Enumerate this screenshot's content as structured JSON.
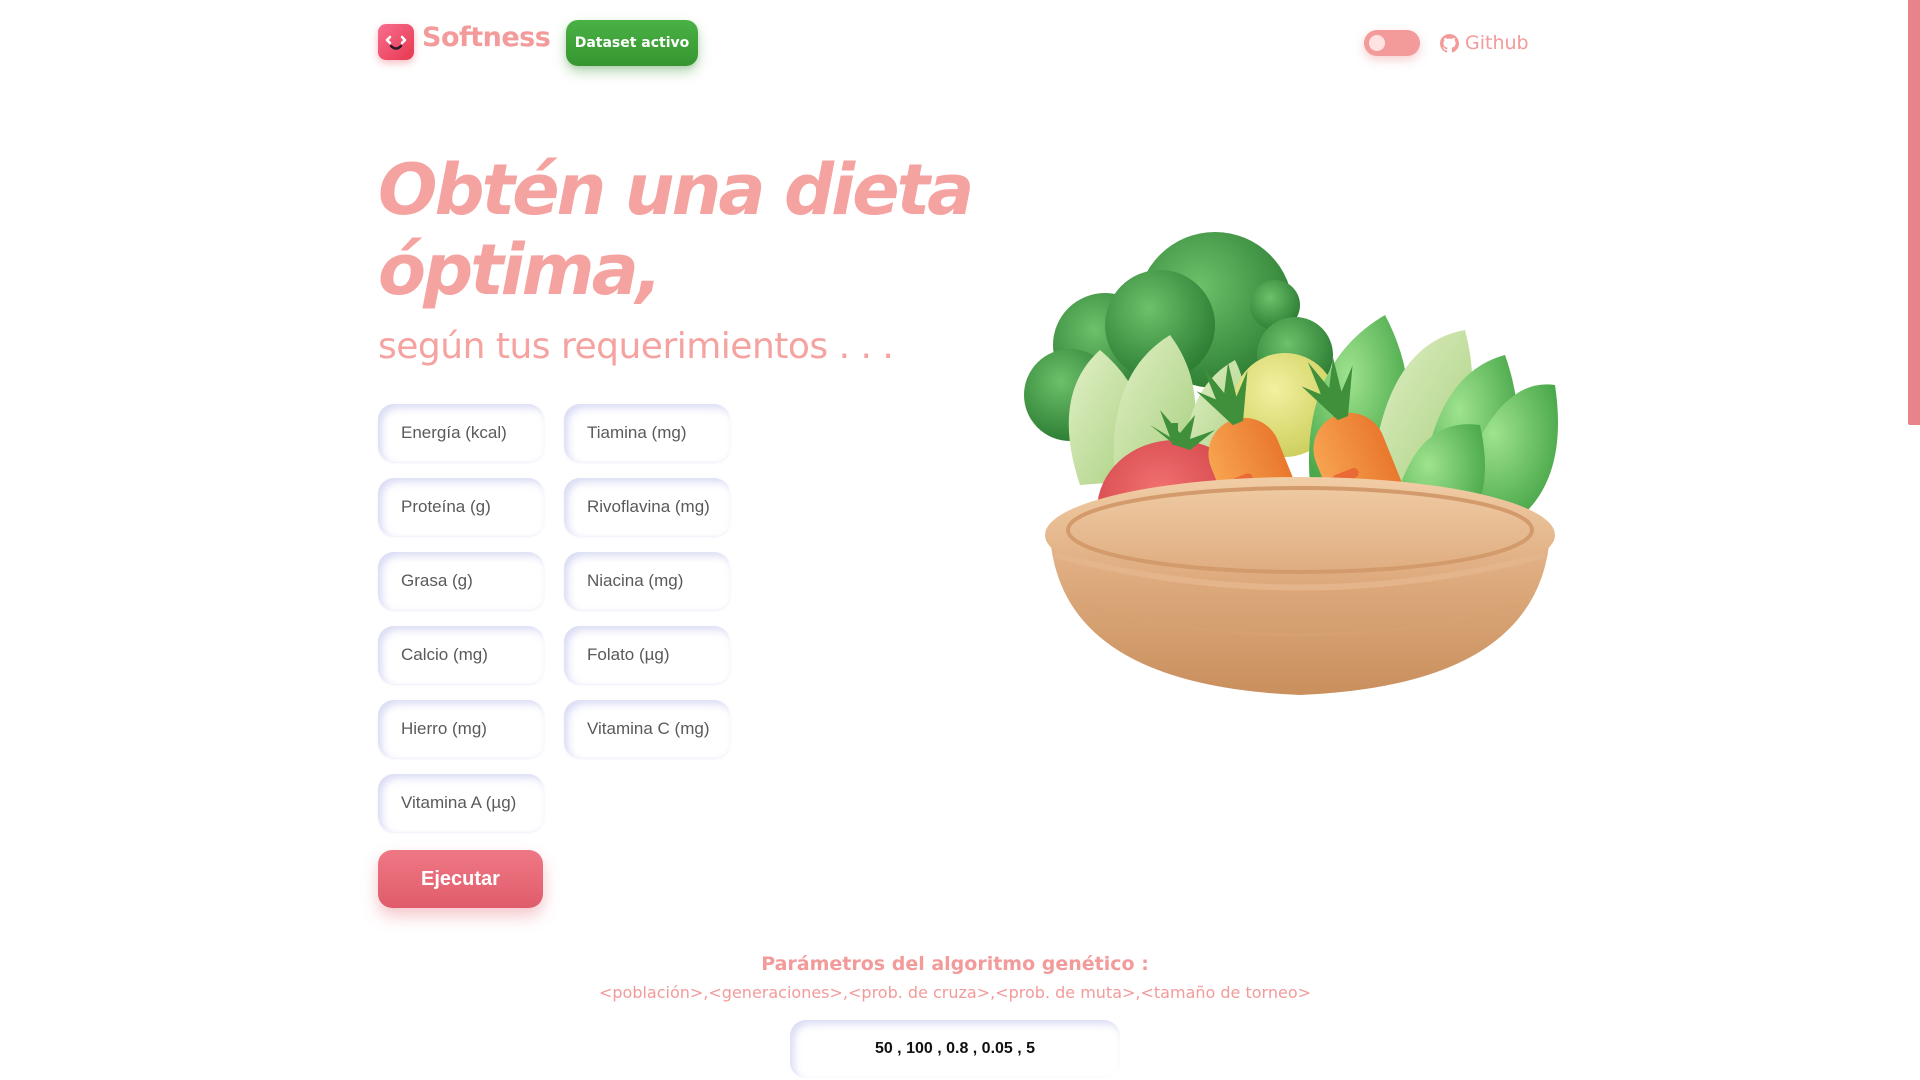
{
  "header": {
    "brand": "Softness",
    "dataset_button": "Dataset activo",
    "github_label": "Github",
    "theme_toggle_on": false
  },
  "hero": {
    "title": "Obtén una dieta óptima,",
    "subtitle": "según tus requerimientos . . ."
  },
  "form": {
    "fields": [
      {
        "placeholder": "Energía (kcal)",
        "value": ""
      },
      {
        "placeholder": "Tiamina (mg)",
        "value": ""
      },
      {
        "placeholder": "Proteína (g)",
        "value": ""
      },
      {
        "placeholder": "Rivoflavina (mg)",
        "value": ""
      },
      {
        "placeholder": "Grasa (g)",
        "value": ""
      },
      {
        "placeholder": "Niacina (mg)",
        "value": ""
      },
      {
        "placeholder": "Calcio (mg)",
        "value": ""
      },
      {
        "placeholder": "Folato (µg)",
        "value": ""
      },
      {
        "placeholder": "Hierro (mg)",
        "value": ""
      },
      {
        "placeholder": "Vitamina C (mg)",
        "value": ""
      },
      {
        "placeholder": "Vitamina A (µg)",
        "value": ""
      }
    ],
    "run_button": "Ejecutar"
  },
  "params": {
    "title": "Parámetros del algoritmo genético :",
    "hint": "<población>,<generaciones>,<prob. de cruza>,<prob. de muta>,<tamaño de torneo>",
    "value": "50 , 100 , 0.8 , 0.05 , 5"
  },
  "colors": {
    "accent": "#f39a9a",
    "dataset_button": "#3fa53a",
    "run_button": "#e86a78",
    "logo": "#f0506e"
  },
  "icons": {
    "logo": "smile-face-icon",
    "github": "github-icon",
    "illustration": "vegetable-basket-illustration"
  }
}
